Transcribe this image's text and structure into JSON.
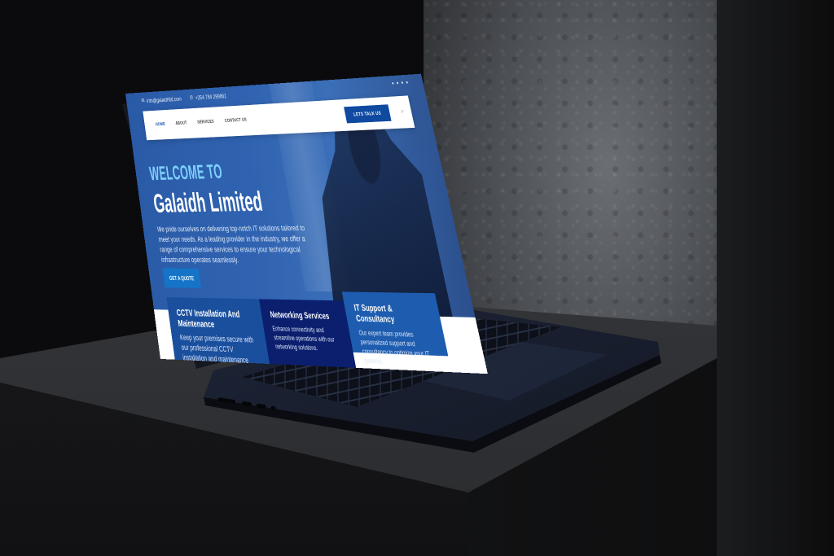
{
  "topbar": {
    "email": "info@galaidhltd.com",
    "phone": "+254 784 299861"
  },
  "nav": {
    "items": [
      "HOME",
      "ABOUT",
      "SERVICES",
      "CONTACT US"
    ],
    "cta": "LETS TALK US"
  },
  "hero": {
    "welcome": "WELCOME TO",
    "company": "Galaidh Limited",
    "description": "We pride ourselves on delivering top-notch IT solutions tailored to meet your needs. As a leading provider in the industry, we offer a range of comprehensive services to ensure your technological infrastructure operates seamlessly.",
    "button": "GET A QUOTE"
  },
  "services": [
    {
      "title": "CCTV Installation And Maintenance",
      "text": "Keep your premises secure with our professional CCTV installation and maintenance services"
    },
    {
      "title": "Networking Services",
      "text": "Enhance connectivity and streamline operations with our networking solutions."
    },
    {
      "title": "IT Support & Consultancy",
      "text": "Our expert team provides personalized support and consultancy to optimize your IT systems."
    }
  ],
  "colors": {
    "hero": "#2f63b1",
    "cta": "#0f4aa0",
    "accent": "#7fd0ff",
    "card_dark": "#0b1f6e"
  }
}
